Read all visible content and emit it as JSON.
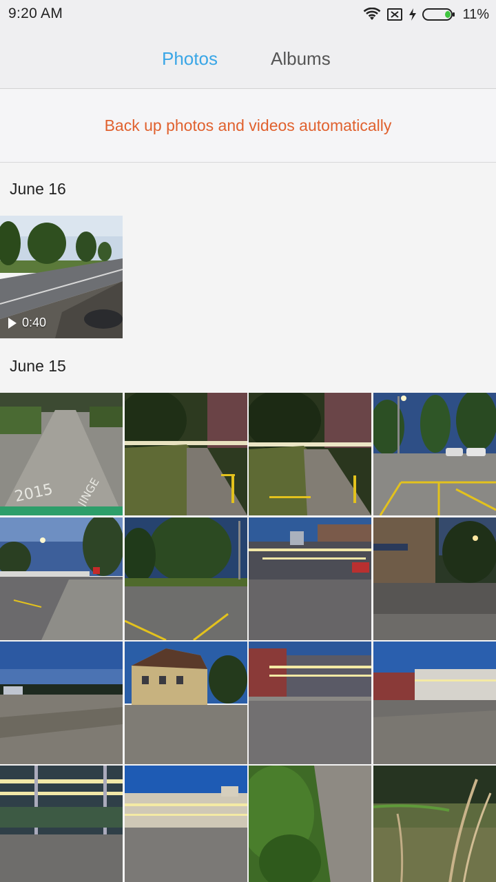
{
  "status_bar": {
    "time": "9:20  AM",
    "battery": "11%",
    "icons": [
      "wifi-icon",
      "no-sim-icon",
      "charging-icon",
      "battery-icon"
    ],
    "battery_color": "#3fc43f"
  },
  "tabs": {
    "photos": "Photos",
    "albums": "Albums",
    "active": "photos",
    "active_color": "#3aa6e6"
  },
  "backup": {
    "text": "Back up photos and videos automatically",
    "color": "#e0612e"
  },
  "sections": [
    {
      "date": "June 16",
      "items": [
        {
          "type": "video",
          "duration": "0:40",
          "scene": "road-trees"
        }
      ]
    },
    {
      "date": "June 15",
      "items": [
        {
          "type": "photo",
          "scene": "path-graffiti"
        },
        {
          "type": "photo",
          "scene": "night-path-trees"
        },
        {
          "type": "photo",
          "scene": "night-path-trees-2"
        },
        {
          "type": "photo",
          "scene": "parking-lot-dusk"
        },
        {
          "type": "photo",
          "scene": "street-dusk"
        },
        {
          "type": "photo",
          "scene": "trees-parking"
        },
        {
          "type": "photo",
          "scene": "station-lights"
        },
        {
          "type": "photo",
          "scene": "building-shop"
        },
        {
          "type": "photo",
          "scene": "plaza-dusk"
        },
        {
          "type": "photo",
          "scene": "yellow-house"
        },
        {
          "type": "photo",
          "scene": "station-plaza"
        },
        {
          "type": "photo",
          "scene": "station-plaza-2"
        },
        {
          "type": "photo",
          "scene": "station-night"
        },
        {
          "type": "photo",
          "scene": "station-facade"
        },
        {
          "type": "photo",
          "scene": "foliage-path"
        },
        {
          "type": "photo",
          "scene": "grass-water"
        }
      ]
    }
  ]
}
